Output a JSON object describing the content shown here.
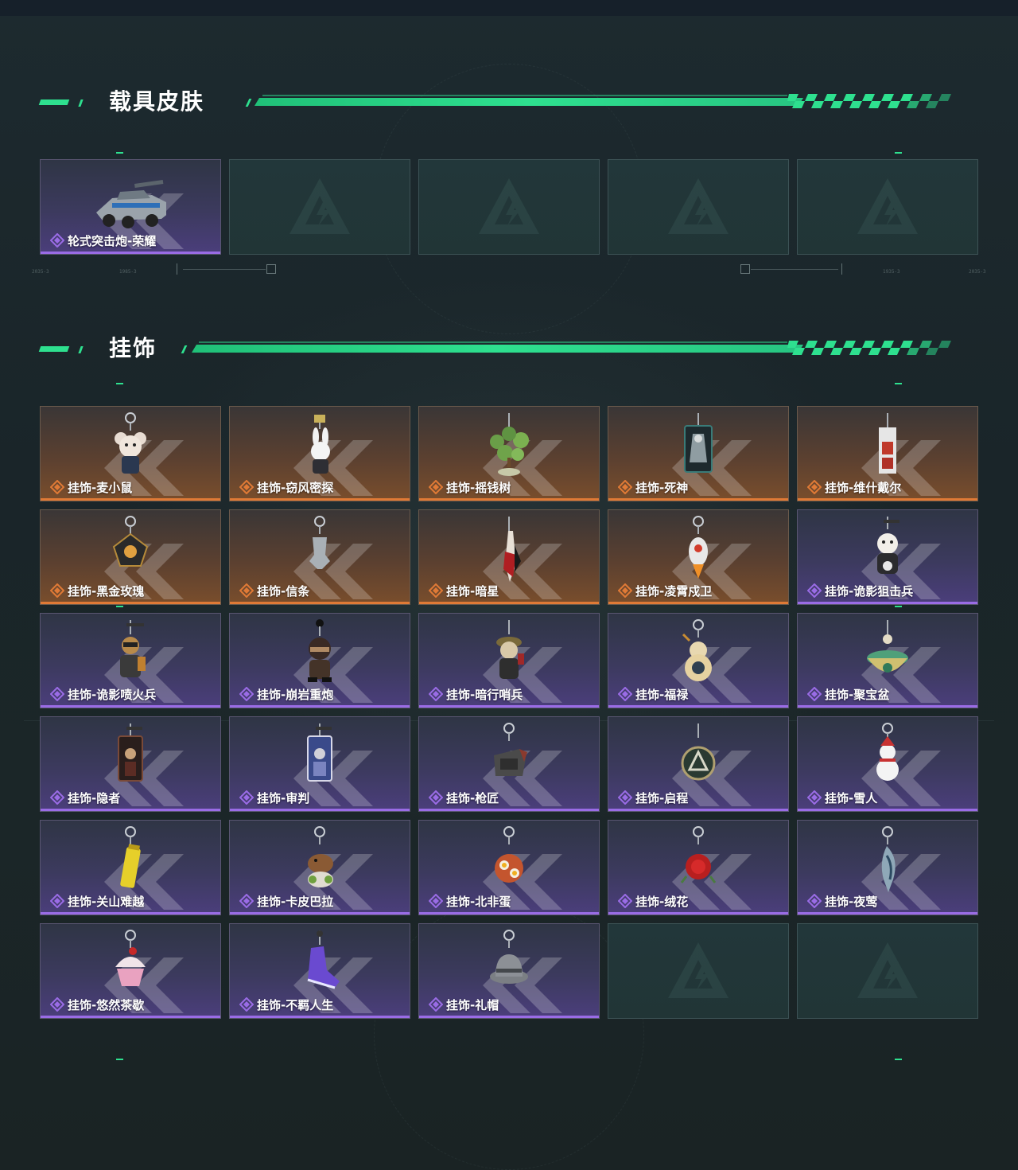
{
  "sections": {
    "vehicle": {
      "title": "载具皮肤"
    },
    "charms": {
      "title": "挂饰"
    }
  },
  "hud": {
    "tick_left_1": "2035-3",
    "tick_left_2": "1985-3",
    "tick_right_1": "1935-3",
    "tick_right_2": "2035-3"
  },
  "colors": {
    "accent": "#2ee08f",
    "orange": "#e07a36",
    "purple": "#9a6ce6"
  },
  "vehicle_cards": [
    {
      "label": "轮式突击炮-荣耀",
      "rarity": "purple",
      "icon": "armored-car-icon"
    },
    {
      "label": "",
      "rarity": "empty"
    },
    {
      "label": "",
      "rarity": "empty"
    },
    {
      "label": "",
      "rarity": "empty"
    },
    {
      "label": "",
      "rarity": "empty"
    }
  ],
  "charm_cards": [
    {
      "label": "挂饰-麦小鼠",
      "rarity": "orange",
      "icon": "mouse-charm-icon"
    },
    {
      "label": "挂饰-窃风密探",
      "rarity": "orange",
      "icon": "rabbit-spy-charm-icon"
    },
    {
      "label": "挂饰-摇钱树",
      "rarity": "orange",
      "icon": "money-tree-charm-icon"
    },
    {
      "label": "挂饰-死神",
      "rarity": "orange",
      "icon": "reaper-card-charm-icon"
    },
    {
      "label": "挂饰-维什戴尔",
      "rarity": "orange",
      "icon": "wisadel-charm-icon"
    },
    {
      "label": "挂饰-黑金玫瑰",
      "rarity": "orange",
      "icon": "black-gold-rose-charm-icon"
    },
    {
      "label": "挂饰-信条",
      "rarity": "orange",
      "icon": "creed-charm-icon"
    },
    {
      "label": "挂饰-暗星",
      "rarity": "orange",
      "icon": "dark-star-charm-icon"
    },
    {
      "label": "挂饰-凌霄戍卫",
      "rarity": "orange",
      "icon": "rocket-guard-charm-icon"
    },
    {
      "label": "挂饰-诡影狙击兵",
      "rarity": "purple",
      "icon": "sniper-charm-icon"
    },
    {
      "label": "挂饰-诡影喷火兵",
      "rarity": "purple",
      "icon": "flamethrower-charm-icon"
    },
    {
      "label": "挂饰-崩岩重炮",
      "rarity": "purple",
      "icon": "heavy-gunner-charm-icon"
    },
    {
      "label": "挂饰-暗行哨兵",
      "rarity": "purple",
      "icon": "sentry-charm-icon"
    },
    {
      "label": "挂饰-福禄",
      "rarity": "purple",
      "icon": "gourd-charm-icon"
    },
    {
      "label": "挂饰-聚宝盆",
      "rarity": "purple",
      "icon": "treasure-bowl-charm-icon"
    },
    {
      "label": "挂饰-隐者",
      "rarity": "purple",
      "icon": "hermit-card-charm-icon"
    },
    {
      "label": "挂饰-审判",
      "rarity": "purple",
      "icon": "judgement-card-charm-icon"
    },
    {
      "label": "挂饰-枪匠",
      "rarity": "purple",
      "icon": "gunsmith-charm-icon"
    },
    {
      "label": "挂饰-启程",
      "rarity": "purple",
      "icon": "departure-medal-charm-icon"
    },
    {
      "label": "挂饰-雪人",
      "rarity": "purple",
      "icon": "snowman-charm-icon"
    },
    {
      "label": "挂饰-关山难越",
      "rarity": "purple",
      "icon": "yellow-bottle-charm-icon"
    },
    {
      "label": "挂饰-卡皮巴拉",
      "rarity": "purple",
      "icon": "capybara-charm-icon"
    },
    {
      "label": "挂饰-北非蛋",
      "rarity": "purple",
      "icon": "shakshuka-charm-icon"
    },
    {
      "label": "挂饰-绒花",
      "rarity": "purple",
      "icon": "velvet-flower-charm-icon"
    },
    {
      "label": "挂饰-夜莺",
      "rarity": "purple",
      "icon": "nightingale-charm-icon"
    },
    {
      "label": "挂饰-悠然茶歇",
      "rarity": "purple",
      "icon": "cupcake-charm-icon"
    },
    {
      "label": "挂饰-不羁人生",
      "rarity": "purple",
      "icon": "sneaker-charm-icon"
    },
    {
      "label": "挂饰-礼帽",
      "rarity": "purple",
      "icon": "fedora-charm-icon"
    },
    {
      "label": "",
      "rarity": "empty"
    },
    {
      "label": "",
      "rarity": "empty"
    }
  ]
}
